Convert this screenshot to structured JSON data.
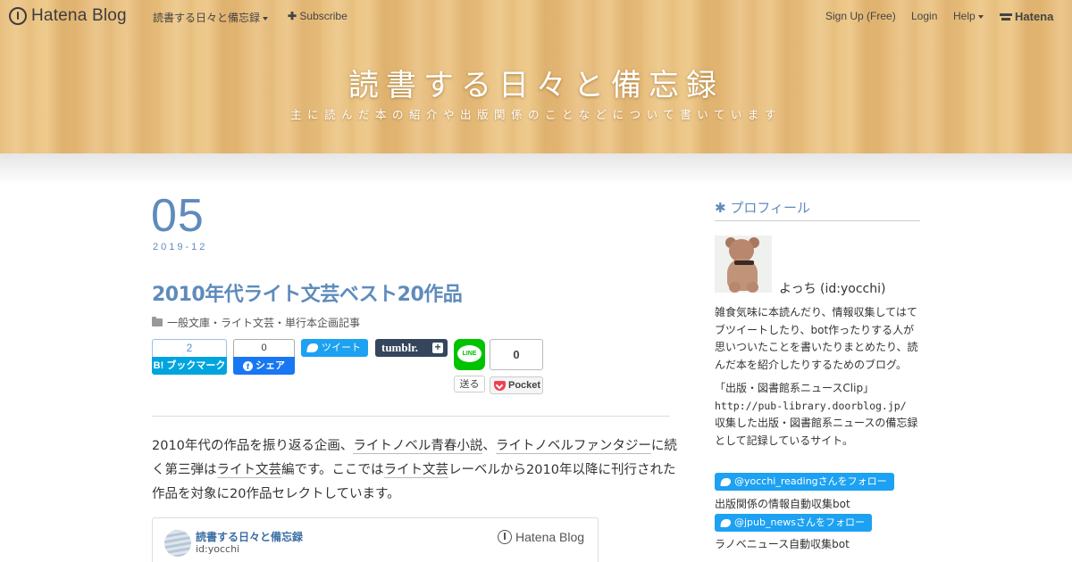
{
  "topbar": {
    "brand": "Hatena Blog",
    "blog_menu": "読書する日々と備忘録",
    "subscribe": "Subscribe",
    "signup": "Sign Up (Free)",
    "login": "Login",
    "help": "Help",
    "hatena": "Hatena"
  },
  "header": {
    "title": "読書する日々と備忘録",
    "description": "主に読んだ本の紹介や出版関係のことなどについて書いています"
  },
  "entry": {
    "day": "05",
    "year_month": "2019-12",
    "title": "2010年代ライト文芸ベスト20作品",
    "category": "一般文庫・ライト文芸・単行本企画記事",
    "share": {
      "hatena_count": "2",
      "hatena_label": "B! ブックマーク",
      "fb_count": "0",
      "fb_label": "シェア",
      "tweet_label": "ツイート",
      "tumblr_label": "tumblr.",
      "line_text": "LINE",
      "line_send": "送る",
      "pocket_count": "0",
      "pocket_label": "Pocket"
    },
    "body": {
      "t1": "2010年代の作品を振り返る企画、",
      "link1": "ライトノベル青春小説",
      "t2": "、",
      "link2": "ライトノベルファンタジー",
      "t3": "に続く第三弾は",
      "link3": "ライト文芸",
      "t4": "編です。ここでは",
      "link4": "ライト文芸",
      "t5": "レーベルから2010年以降に刊行された作品を対象に20作品セレクトしています。"
    },
    "card": {
      "title": "読書する日々と備忘録",
      "id": "id:yocchi",
      "brand": "Hatena Blog"
    }
  },
  "sidebar": {
    "heading": "✱ プロフィール",
    "name": "よっち (id:yocchi)",
    "bio": "雑食気味に本読んだり、情報収集してはてブツイートしたり、bot作ったりする人が思いついたことを書いたりまとめたり、読んだ本を紹介したりするためのブログ。",
    "clip_title": "「出版・図書館系ニュースClip」",
    "clip_url": "http://pub-library.doorblog.jp/",
    "clip_desc": "収集した出版・図書館系ニュースの備忘録として記録しているサイト。",
    "follow1": "@yocchi_readingさんをフォロー",
    "bot1_label": "出版関係の情報自動収集bot",
    "follow2": "@jpub_newsさんをフォロー",
    "bot2_label": "ラノベニュース自動収集bot"
  }
}
